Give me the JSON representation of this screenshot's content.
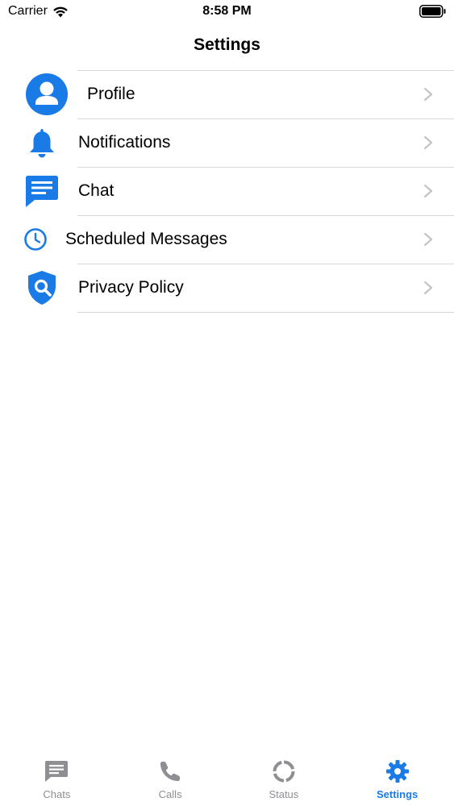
{
  "status_bar": {
    "carrier": "Carrier",
    "time": "8:58 PM"
  },
  "nav": {
    "title": "Settings"
  },
  "settings": {
    "items": [
      {
        "label": "Profile",
        "icon": "profile-icon"
      },
      {
        "label": "Notifications",
        "icon": "bell-icon"
      },
      {
        "label": "Chat",
        "icon": "chat-bubble-icon"
      },
      {
        "label": "Scheduled Messages",
        "icon": "clock-icon"
      },
      {
        "label": "Privacy Policy",
        "icon": "shield-search-icon"
      }
    ]
  },
  "tab_bar": {
    "tabs": [
      {
        "label": "Chats",
        "icon": "message-icon",
        "active": false
      },
      {
        "label": "Calls",
        "icon": "phone-icon",
        "active": false
      },
      {
        "label": "Status",
        "icon": "status-ring-icon",
        "active": false
      },
      {
        "label": "Settings",
        "icon": "gear-icon",
        "active": true
      }
    ]
  },
  "colors": {
    "accent": "#1a7ae6",
    "inactive": "#8e8e93",
    "separator": "#d8d8dc",
    "chevron": "#c4c4c7"
  }
}
